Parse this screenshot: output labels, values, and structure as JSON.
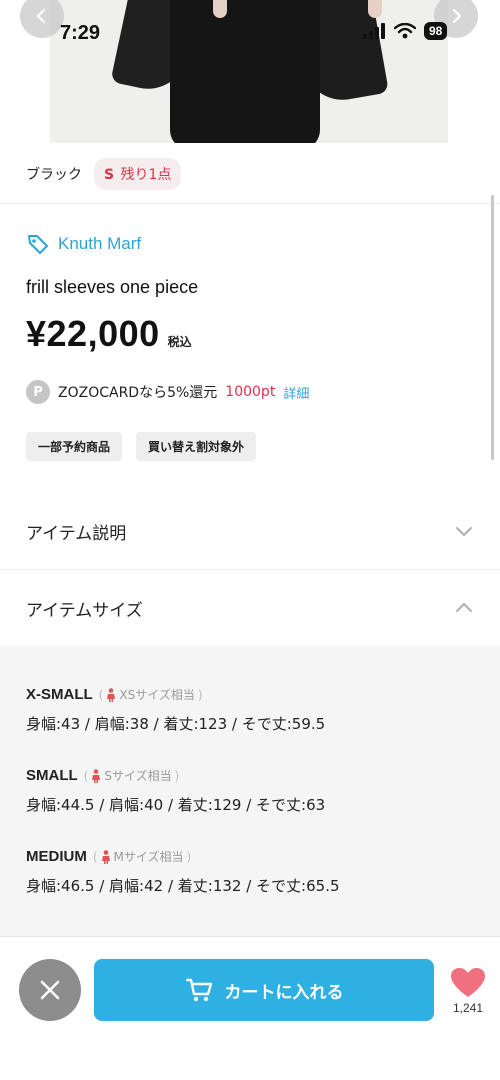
{
  "status_bar": {
    "time": "7:29",
    "battery": "98"
  },
  "product": {
    "color": "ブラック",
    "stock": {
      "size": "S",
      "text": "残り1点"
    },
    "brand": "Knuth Marf",
    "title": "frill sleeves one piece",
    "price": "¥22,000",
    "tax_label": "税込",
    "points": {
      "icon_letter": "P",
      "text": "ZOZOCARDなら5%還元",
      "value": "1000pt",
      "link": "詳細"
    },
    "tags": [
      "一部予約商品",
      "買い替え割対象外"
    ]
  },
  "sections": {
    "description_title": "アイテム説明",
    "size_title": "アイテムサイズ"
  },
  "sizes": [
    {
      "name": "X-SMALL",
      "equiv": "XSサイズ相当",
      "dims": "身幅:43 / 肩幅:38 / 着丈:123 / そで丈:59.5"
    },
    {
      "name": "SMALL",
      "equiv": "Sサイズ相当",
      "dims": "身幅:44.5 / 肩幅:40 / 着丈:129 / そで丈:63"
    },
    {
      "name": "MEDIUM",
      "equiv": "Mサイズ相当",
      "dims": "身幅:46.5 / 肩幅:42 / 着丈:132 / そで丈:65.5"
    }
  ],
  "bottom_bar": {
    "cart_label": "カートに入れる",
    "favorite_count": "1,241"
  },
  "colors": {
    "accent_blue": "#2fb0e2",
    "brand_blue": "#2aa5d3",
    "stock_red": "#d8354b",
    "heart_pink": "#f07080"
  }
}
